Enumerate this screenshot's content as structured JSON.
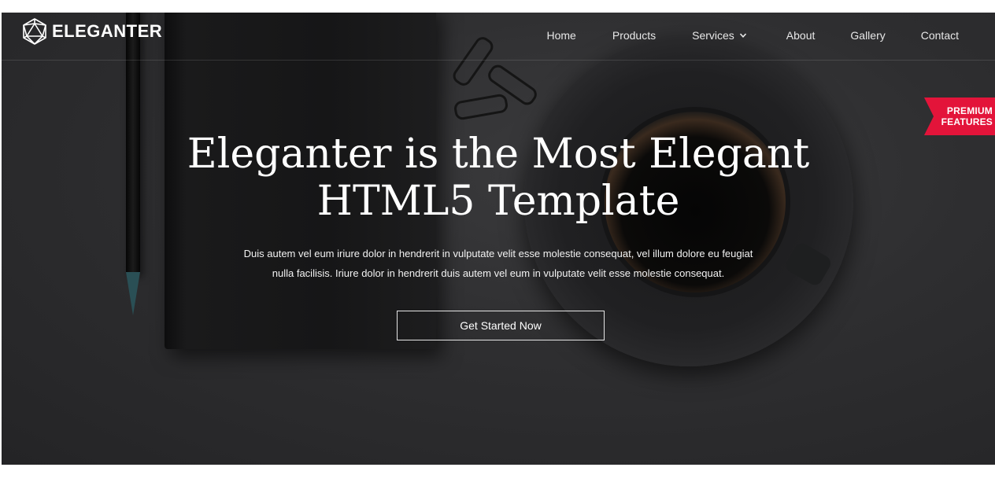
{
  "brand": {
    "name": "ELEGANTER",
    "logo_icon": "geodesic-polyhedron-icon"
  },
  "nav": {
    "items": [
      {
        "label": "Home"
      },
      {
        "label": "Products"
      },
      {
        "label": "Services",
        "has_dropdown": true,
        "dropdown_icon": "chevron-down-icon"
      },
      {
        "label": "About"
      },
      {
        "label": "Gallery"
      },
      {
        "label": "Contact"
      }
    ]
  },
  "badge": {
    "line1": "PREMIUM",
    "line2": "FEATURES",
    "color": "#e3143a"
  },
  "hero": {
    "headline_line1": "Eleganter is the Most Elegant",
    "headline_line2": "HTML5 Template",
    "subtext_line1": "Duis autem vel eum iriure dolor in hendrerit in vulputate velit esse molestie consequat, vel illum dolore eu feugiat",
    "subtext_line2": "nulla facilisis. Iriure dolor in hendrerit duis autem vel eum in vulputate velit esse molestie consequat.",
    "cta_label": "Get Started Now"
  },
  "colors": {
    "background": "#2e2e30",
    "text": "#ffffff",
    "accent": "#e3143a"
  }
}
